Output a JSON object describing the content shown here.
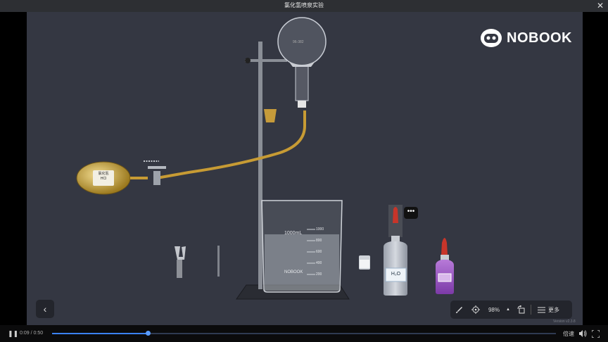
{
  "window": {
    "title": "氯化氢喷泉实验",
    "close_icon": "close-icon"
  },
  "brand": {
    "name": "NOBOOK",
    "icon": "robot-face-icon"
  },
  "apparatus": {
    "bulb_label_line1": "氯化氢",
    "bulb_label_line2": "HCl",
    "flask_label": "96-382",
    "beaker_volume": "1000mL",
    "beaker_brand": "NOBOOK",
    "beaker_marks": [
      "1000",
      "800",
      "600",
      "400",
      "200"
    ],
    "water_bottle_label": "H₂O",
    "more_label": "•••"
  },
  "toolbar": {
    "zoom": "98%",
    "more_label": "更多",
    "version": "Version v2.3.8",
    "icons": [
      "brush-icon",
      "locate-icon",
      "caret-up-icon",
      "rotate-icon",
      "list-icon"
    ]
  },
  "player": {
    "current_time": "0:09",
    "separator": "/",
    "duration": "0:50",
    "progress": 0.19,
    "speed_label": "倍速",
    "colors": {
      "accent": "#3b82f6"
    }
  }
}
